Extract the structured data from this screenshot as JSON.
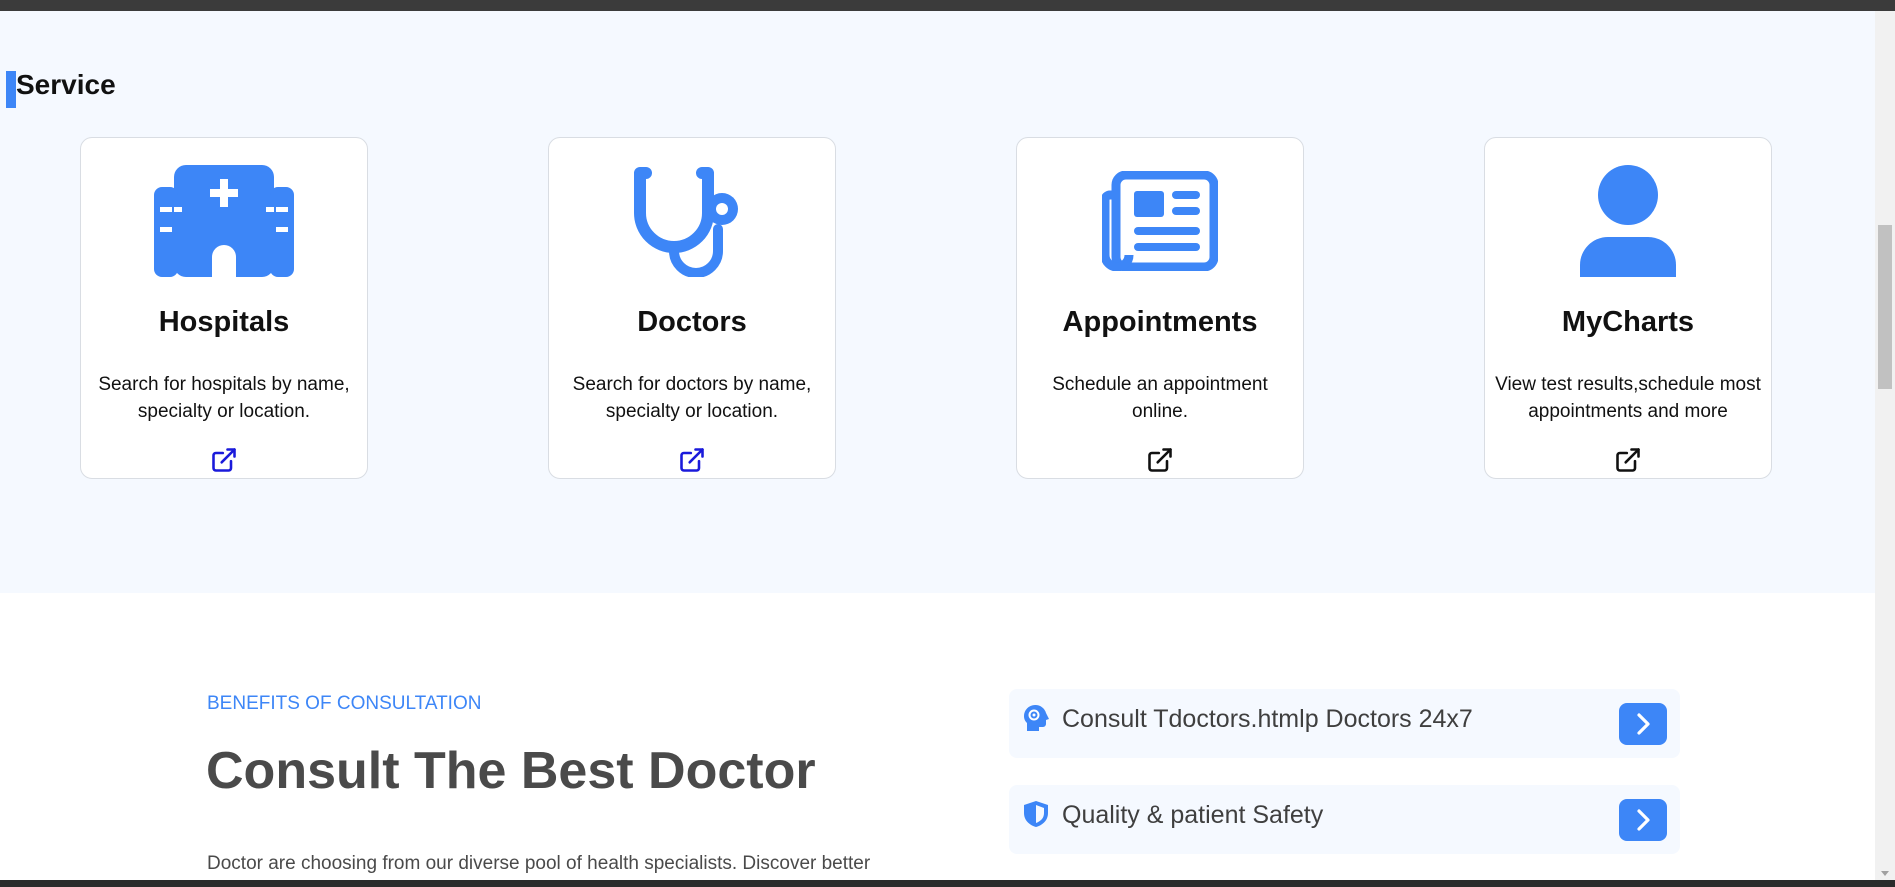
{
  "service": {
    "title": "Service",
    "cards": [
      {
        "title": "Hospitals",
        "desc": "Search for hospitals by name, specialty or location.",
        "icon": "hospital-icon",
        "link_color": "#1a1adb"
      },
      {
        "title": "Doctors",
        "desc": "Search for doctors by name, specialty or location.",
        "icon": "stethoscope-icon",
        "link_color": "#1a1adb"
      },
      {
        "title": "Appointments",
        "desc": "Schedule an appointment online.",
        "icon": "newspaper-icon",
        "link_color": "#111111"
      },
      {
        "title": "MyCharts",
        "desc": "View test results,schedule most appointments and more",
        "icon": "user-icon",
        "link_color": "#111111"
      }
    ]
  },
  "consult": {
    "eyebrow": "BENEFITS OF CONSULTATION",
    "title": "Consult The Best Doctor",
    "lead": "Doctor are choosing from our diverse pool of health specialists. Discover better",
    "benefits": [
      {
        "label": "Consult Tdoctors.htmlp Doctors 24x7",
        "icon": "head-gear-icon"
      },
      {
        "label": "Quality & patient Safety",
        "icon": "shield-icon"
      }
    ]
  },
  "colors": {
    "accent": "#3d86f7",
    "section_bg": "#f5f9ff"
  }
}
